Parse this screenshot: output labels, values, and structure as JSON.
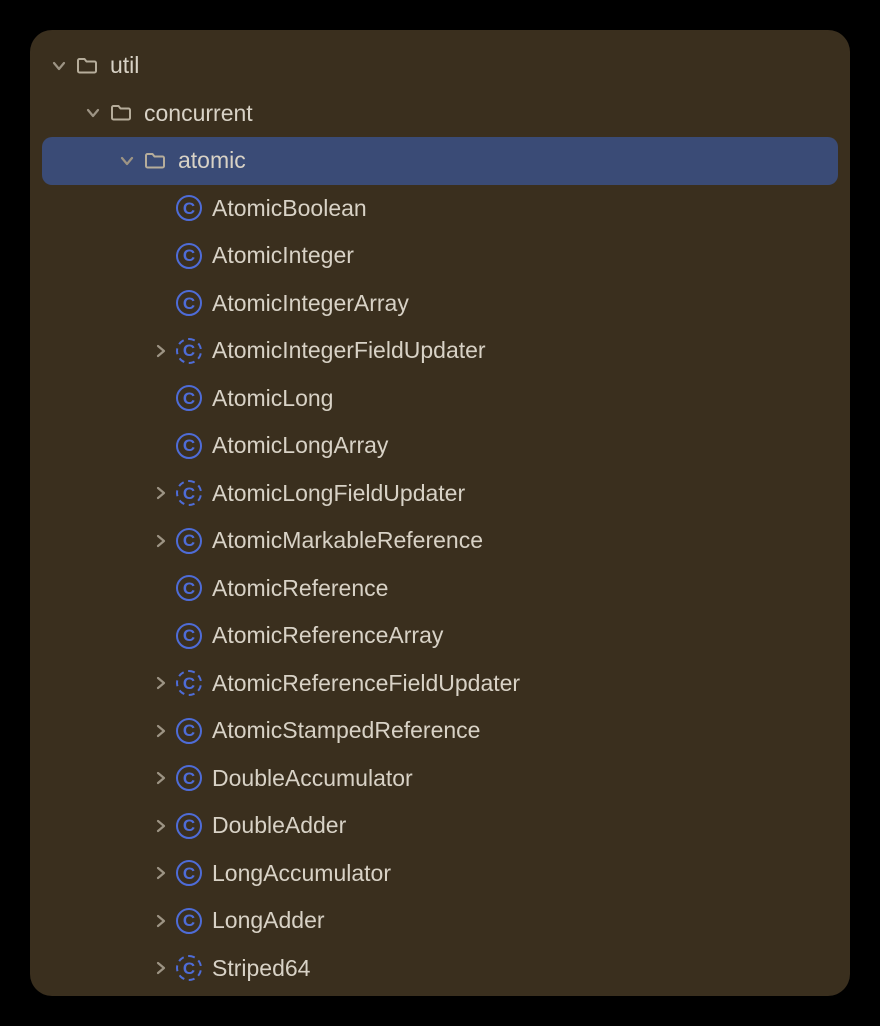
{
  "tree": [
    {
      "label": "util",
      "level": 0,
      "kind": "folder",
      "arrow": "down",
      "selected": false
    },
    {
      "label": "concurrent",
      "level": 1,
      "kind": "folder",
      "arrow": "down",
      "selected": false
    },
    {
      "label": "atomic",
      "level": 2,
      "kind": "folder",
      "arrow": "down",
      "selected": true
    },
    {
      "label": "AtomicBoolean",
      "level": 3,
      "kind": "class",
      "arrow": "none",
      "selected": false
    },
    {
      "label": "AtomicInteger",
      "level": 3,
      "kind": "class",
      "arrow": "none",
      "selected": false
    },
    {
      "label": "AtomicIntegerArray",
      "level": 3,
      "kind": "class",
      "arrow": "none",
      "selected": false
    },
    {
      "label": "AtomicIntegerFieldUpdater",
      "level": 3,
      "kind": "abstract-class",
      "arrow": "right",
      "selected": false
    },
    {
      "label": "AtomicLong",
      "level": 3,
      "kind": "class",
      "arrow": "none",
      "selected": false
    },
    {
      "label": "AtomicLongArray",
      "level": 3,
      "kind": "class",
      "arrow": "none",
      "selected": false
    },
    {
      "label": "AtomicLongFieldUpdater",
      "level": 3,
      "kind": "abstract-class",
      "arrow": "right",
      "selected": false
    },
    {
      "label": "AtomicMarkableReference",
      "level": 3,
      "kind": "class",
      "arrow": "right",
      "selected": false
    },
    {
      "label": "AtomicReference",
      "level": 3,
      "kind": "class",
      "arrow": "none",
      "selected": false
    },
    {
      "label": "AtomicReferenceArray",
      "level": 3,
      "kind": "class",
      "arrow": "none",
      "selected": false
    },
    {
      "label": "AtomicReferenceFieldUpdater",
      "level": 3,
      "kind": "abstract-class",
      "arrow": "right",
      "selected": false
    },
    {
      "label": "AtomicStampedReference",
      "level": 3,
      "kind": "class",
      "arrow": "right",
      "selected": false
    },
    {
      "label": "DoubleAccumulator",
      "level": 3,
      "kind": "class",
      "arrow": "right",
      "selected": false
    },
    {
      "label": "DoubleAdder",
      "level": 3,
      "kind": "class",
      "arrow": "right",
      "selected": false
    },
    {
      "label": "LongAccumulator",
      "level": 3,
      "kind": "class",
      "arrow": "right",
      "selected": false
    },
    {
      "label": "LongAdder",
      "level": 3,
      "kind": "class",
      "arrow": "right",
      "selected": false
    },
    {
      "label": "Striped64",
      "level": 3,
      "kind": "abstract-class",
      "arrow": "right",
      "selected": false
    }
  ],
  "arrow_color": "#9d9484",
  "folder_color": "#b6ad9b",
  "class_letter": "C",
  "indent_unit": 34,
  "base_pad": 16,
  "selected_base_pad": 4
}
